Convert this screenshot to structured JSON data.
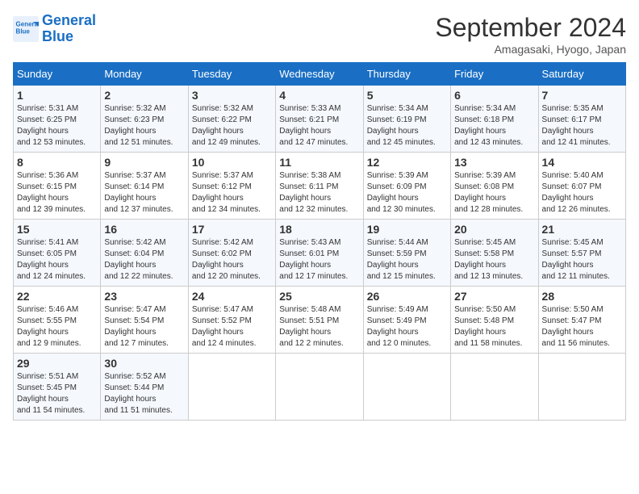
{
  "header": {
    "logo_line1": "General",
    "logo_line2": "Blue",
    "month_title": "September 2024",
    "location": "Amagasaki, Hyogo, Japan"
  },
  "weekdays": [
    "Sunday",
    "Monday",
    "Tuesday",
    "Wednesday",
    "Thursday",
    "Friday",
    "Saturday"
  ],
  "weeks": [
    [
      {
        "day": "1",
        "sunrise": "5:31 AM",
        "sunset": "6:25 PM",
        "daylight": "12 hours and 53 minutes."
      },
      {
        "day": "2",
        "sunrise": "5:32 AM",
        "sunset": "6:23 PM",
        "daylight": "12 hours and 51 minutes."
      },
      {
        "day": "3",
        "sunrise": "5:32 AM",
        "sunset": "6:22 PM",
        "daylight": "12 hours and 49 minutes."
      },
      {
        "day": "4",
        "sunrise": "5:33 AM",
        "sunset": "6:21 PM",
        "daylight": "12 hours and 47 minutes."
      },
      {
        "day": "5",
        "sunrise": "5:34 AM",
        "sunset": "6:19 PM",
        "daylight": "12 hours and 45 minutes."
      },
      {
        "day": "6",
        "sunrise": "5:34 AM",
        "sunset": "6:18 PM",
        "daylight": "12 hours and 43 minutes."
      },
      {
        "day": "7",
        "sunrise": "5:35 AM",
        "sunset": "6:17 PM",
        "daylight": "12 hours and 41 minutes."
      }
    ],
    [
      {
        "day": "8",
        "sunrise": "5:36 AM",
        "sunset": "6:15 PM",
        "daylight": "12 hours and 39 minutes."
      },
      {
        "day": "9",
        "sunrise": "5:37 AM",
        "sunset": "6:14 PM",
        "daylight": "12 hours and 37 minutes."
      },
      {
        "day": "10",
        "sunrise": "5:37 AM",
        "sunset": "6:12 PM",
        "daylight": "12 hours and 34 minutes."
      },
      {
        "day": "11",
        "sunrise": "5:38 AM",
        "sunset": "6:11 PM",
        "daylight": "12 hours and 32 minutes."
      },
      {
        "day": "12",
        "sunrise": "5:39 AM",
        "sunset": "6:09 PM",
        "daylight": "12 hours and 30 minutes."
      },
      {
        "day": "13",
        "sunrise": "5:39 AM",
        "sunset": "6:08 PM",
        "daylight": "12 hours and 28 minutes."
      },
      {
        "day": "14",
        "sunrise": "5:40 AM",
        "sunset": "6:07 PM",
        "daylight": "12 hours and 26 minutes."
      }
    ],
    [
      {
        "day": "15",
        "sunrise": "5:41 AM",
        "sunset": "6:05 PM",
        "daylight": "12 hours and 24 minutes."
      },
      {
        "day": "16",
        "sunrise": "5:42 AM",
        "sunset": "6:04 PM",
        "daylight": "12 hours and 22 minutes."
      },
      {
        "day": "17",
        "sunrise": "5:42 AM",
        "sunset": "6:02 PM",
        "daylight": "12 hours and 20 minutes."
      },
      {
        "day": "18",
        "sunrise": "5:43 AM",
        "sunset": "6:01 PM",
        "daylight": "12 hours and 17 minutes."
      },
      {
        "day": "19",
        "sunrise": "5:44 AM",
        "sunset": "5:59 PM",
        "daylight": "12 hours and 15 minutes."
      },
      {
        "day": "20",
        "sunrise": "5:45 AM",
        "sunset": "5:58 PM",
        "daylight": "12 hours and 13 minutes."
      },
      {
        "day": "21",
        "sunrise": "5:45 AM",
        "sunset": "5:57 PM",
        "daylight": "12 hours and 11 minutes."
      }
    ],
    [
      {
        "day": "22",
        "sunrise": "5:46 AM",
        "sunset": "5:55 PM",
        "daylight": "12 hours and 9 minutes."
      },
      {
        "day": "23",
        "sunrise": "5:47 AM",
        "sunset": "5:54 PM",
        "daylight": "12 hours and 7 minutes."
      },
      {
        "day": "24",
        "sunrise": "5:47 AM",
        "sunset": "5:52 PM",
        "daylight": "12 hours and 4 minutes."
      },
      {
        "day": "25",
        "sunrise": "5:48 AM",
        "sunset": "5:51 PM",
        "daylight": "12 hours and 2 minutes."
      },
      {
        "day": "26",
        "sunrise": "5:49 AM",
        "sunset": "5:49 PM",
        "daylight": "12 hours and 0 minutes."
      },
      {
        "day": "27",
        "sunrise": "5:50 AM",
        "sunset": "5:48 PM",
        "daylight": "11 hours and 58 minutes."
      },
      {
        "day": "28",
        "sunrise": "5:50 AM",
        "sunset": "5:47 PM",
        "daylight": "11 hours and 56 minutes."
      }
    ],
    [
      {
        "day": "29",
        "sunrise": "5:51 AM",
        "sunset": "5:45 PM",
        "daylight": "11 hours and 54 minutes."
      },
      {
        "day": "30",
        "sunrise": "5:52 AM",
        "sunset": "5:44 PM",
        "daylight": "11 hours and 51 minutes."
      },
      null,
      null,
      null,
      null,
      null
    ]
  ]
}
